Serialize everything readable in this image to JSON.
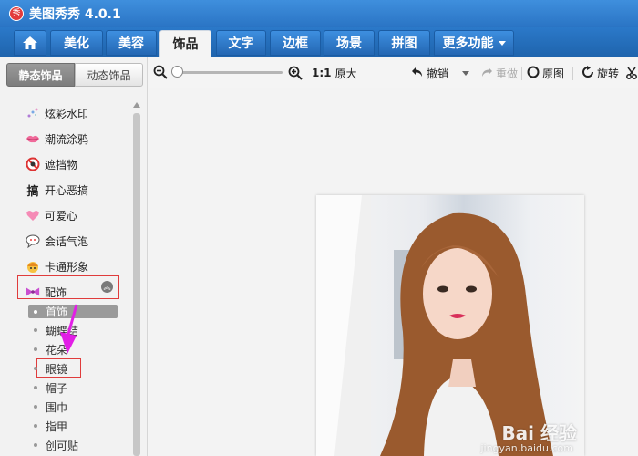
{
  "window": {
    "title": "美图秀秀 4.0.1",
    "logo_text": "秀"
  },
  "menu_tabs": [
    {
      "label": "美化"
    },
    {
      "label": "美容"
    },
    {
      "label": "饰品"
    },
    {
      "label": "文字"
    },
    {
      "label": "边框"
    },
    {
      "label": "场景"
    },
    {
      "label": "拼图"
    },
    {
      "label": "更多功能"
    }
  ],
  "panel_tabs": {
    "static": "静态饰品",
    "dynamic": "动态饰品"
  },
  "categories": [
    {
      "label": "炫彩水印",
      "icon": "sparkle-watermark-icon"
    },
    {
      "label": "潮流涂鸦",
      "icon": "lips-icon"
    },
    {
      "label": "遮挡物",
      "icon": "block-icon"
    },
    {
      "label": "开心恶搞",
      "icon": "prank-icon",
      "icon_text": "搞"
    },
    {
      "label": "可爱心",
      "icon": "heart-icon"
    },
    {
      "label": "会话气泡",
      "icon": "speech-bubble-icon"
    },
    {
      "label": "卡通形象",
      "icon": "cartoon-icon"
    },
    {
      "label": "配饰",
      "icon": "bow-icon"
    }
  ],
  "accessory_subitems": [
    {
      "label": "首饰"
    },
    {
      "label": "蝴蝶结"
    },
    {
      "label": "花朵"
    },
    {
      "label": "眼镜"
    },
    {
      "label": "帽子"
    },
    {
      "label": "围巾"
    },
    {
      "label": "指甲"
    },
    {
      "label": "创可贴"
    }
  ],
  "toolbar": {
    "ratio": "1:1",
    "original_size": "原大",
    "undo": "撤销",
    "redo": "重做",
    "original_image": "原图",
    "rotate": "旋转"
  },
  "watermark": {
    "brand": "Bai 经验",
    "url": "jingyan.baidu.com"
  },
  "colors": {
    "accent": "#2b79c9",
    "highlight_border": "#e03c3c",
    "arrow": "#e21ee6"
  }
}
